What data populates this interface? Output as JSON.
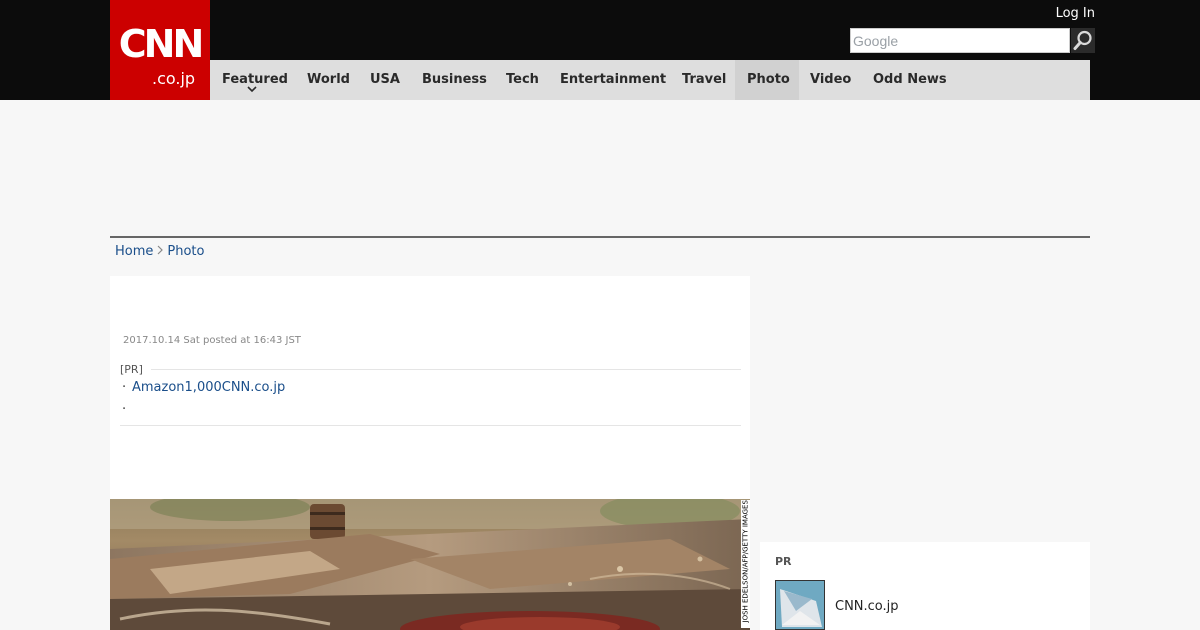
{
  "header": {
    "logo_text": "CNN",
    "logo_subtext": ".co.jp",
    "login_label": "Log In",
    "search_placeholder": "Google"
  },
  "nav": {
    "items": [
      {
        "label": "Featured"
      },
      {
        "label": "World"
      },
      {
        "label": "USA"
      },
      {
        "label": "Business"
      },
      {
        "label": "Tech"
      },
      {
        "label": "Entertainment"
      },
      {
        "label": "Travel"
      },
      {
        "label": "Photo",
        "active": true
      },
      {
        "label": "Video"
      },
      {
        "label": "Odd News"
      }
    ]
  },
  "breadcrumb": {
    "home": "Home",
    "current": "Photo"
  },
  "article": {
    "date": "2017.10.14 Sat posted at 16:43 JST",
    "pr_label": "[PR]",
    "pr_links": [
      "Amazon1,000CNN.co.jp",
      ""
    ],
    "photo_credit": "JOSH EDELSON/AFP/GETTY IMAGES"
  },
  "sidebar": {
    "pr_label": "PR",
    "item_title": "CNN.co.jp"
  },
  "colors": {
    "header_bg": "#0c0c0c",
    "logo_red": "#cc0000",
    "nav_bg": "#dedede",
    "link_blue": "#1a4e8a"
  },
  "icons": {
    "search": "magnifier-icon",
    "breadcrumb_separator": "chevron-right-icon",
    "nav_featured_caret": "chevron-down-icon"
  }
}
